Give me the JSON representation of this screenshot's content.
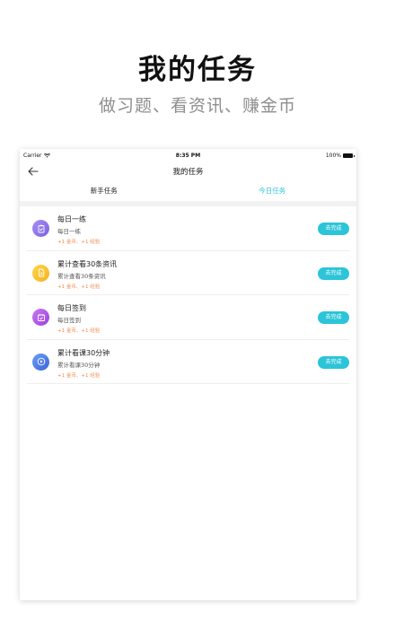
{
  "promo": {
    "title": "我的任务",
    "subtitle": "做习题、看资讯、赚金币"
  },
  "status_bar": {
    "carrier": "Carrier",
    "time": "8:35 PM",
    "battery": "100%"
  },
  "nav": {
    "title": "我的任务"
  },
  "tabs": [
    {
      "label": "新手任务",
      "active": false
    },
    {
      "label": "今日任务",
      "active": true
    }
  ],
  "tasks": [
    {
      "title": "每日一练",
      "desc": "每日一练",
      "reward": "+1 金币、+1 经验",
      "button": "去完成",
      "icon": "clipboard-check-icon",
      "color": "#8a6fe8"
    },
    {
      "title": "累计查看30条资讯",
      "desc": "累计查看30条资讯",
      "reward": "+1 金币、+1 经验",
      "button": "去完成",
      "icon": "document-icon",
      "color": "#f6bf1e"
    },
    {
      "title": "每日签到",
      "desc": "每日签到",
      "reward": "+1 金币、+1 经验",
      "button": "去完成",
      "icon": "calendar-check-icon",
      "color": "#b254e6"
    },
    {
      "title": "累计看课30分钟",
      "desc": "累计看课30分钟",
      "reward": "+1 金币、+1 经验",
      "button": "去完成",
      "icon": "play-circle-icon",
      "color": "#4f7de6"
    }
  ],
  "colors": {
    "accent": "#2cc4d8",
    "reward": "#f08a4b"
  }
}
